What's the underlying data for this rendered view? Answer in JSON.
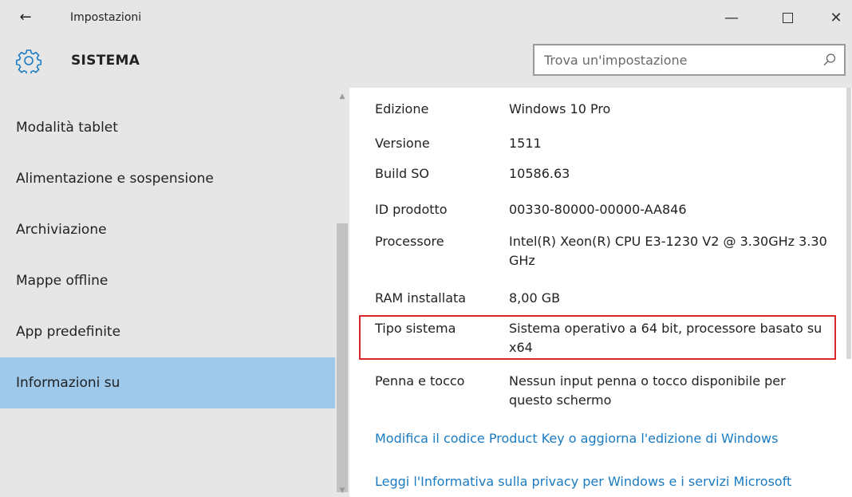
{
  "window": {
    "back_glyph": "←",
    "title": "Impostazioni",
    "minimize_glyph": "—",
    "close_glyph": "✕"
  },
  "header": {
    "icon": "gear-icon",
    "title": "SISTEMA"
  },
  "search": {
    "placeholder": "Trova un'impostazione",
    "value": "",
    "icon": "search-icon"
  },
  "sidebar": {
    "items": [
      {
        "label": "Modalità tablet",
        "selected": false
      },
      {
        "label": "Alimentazione e sospensione",
        "selected": false
      },
      {
        "label": "Archiviazione",
        "selected": false
      },
      {
        "label": "Mappe offline",
        "selected": false
      },
      {
        "label": "App predefinite",
        "selected": false
      },
      {
        "label": "Informazioni su",
        "selected": true
      }
    ]
  },
  "info": [
    {
      "label": "Edizione",
      "value": "Windows 10 Pro"
    },
    {
      "label": "Versione",
      "value": "1511"
    },
    {
      "label": "Build SO",
      "value": "10586.63"
    },
    {
      "label": "ID prodotto",
      "value": "00330-80000-00000-AA846"
    },
    {
      "label": "Processore",
      "value": "Intel(R) Xeon(R) CPU E3-1230 V2 @ 3.30GHz 3.30 GHz"
    },
    {
      "label": "RAM installata",
      "value": "8,00 GB"
    },
    {
      "label": "Tipo sistema",
      "value": "Sistema operativo a 64 bit, processore basato su x64"
    },
    {
      "label": "Penna e tocco",
      "value": "Nessun input penna o tocco disponibile per questo schermo"
    }
  ],
  "links": [
    "Modifica il codice Product Key o aggiorna l'edizione di Windows",
    "Leggi l'Informativa sulla privacy per Windows e i servizi Microsoft"
  ],
  "colors": {
    "chrome_bg": "#e6e6e6",
    "selected_bg": "#9ec9eb",
    "link": "#1a7bc2",
    "highlight_border": "#d9262b"
  }
}
